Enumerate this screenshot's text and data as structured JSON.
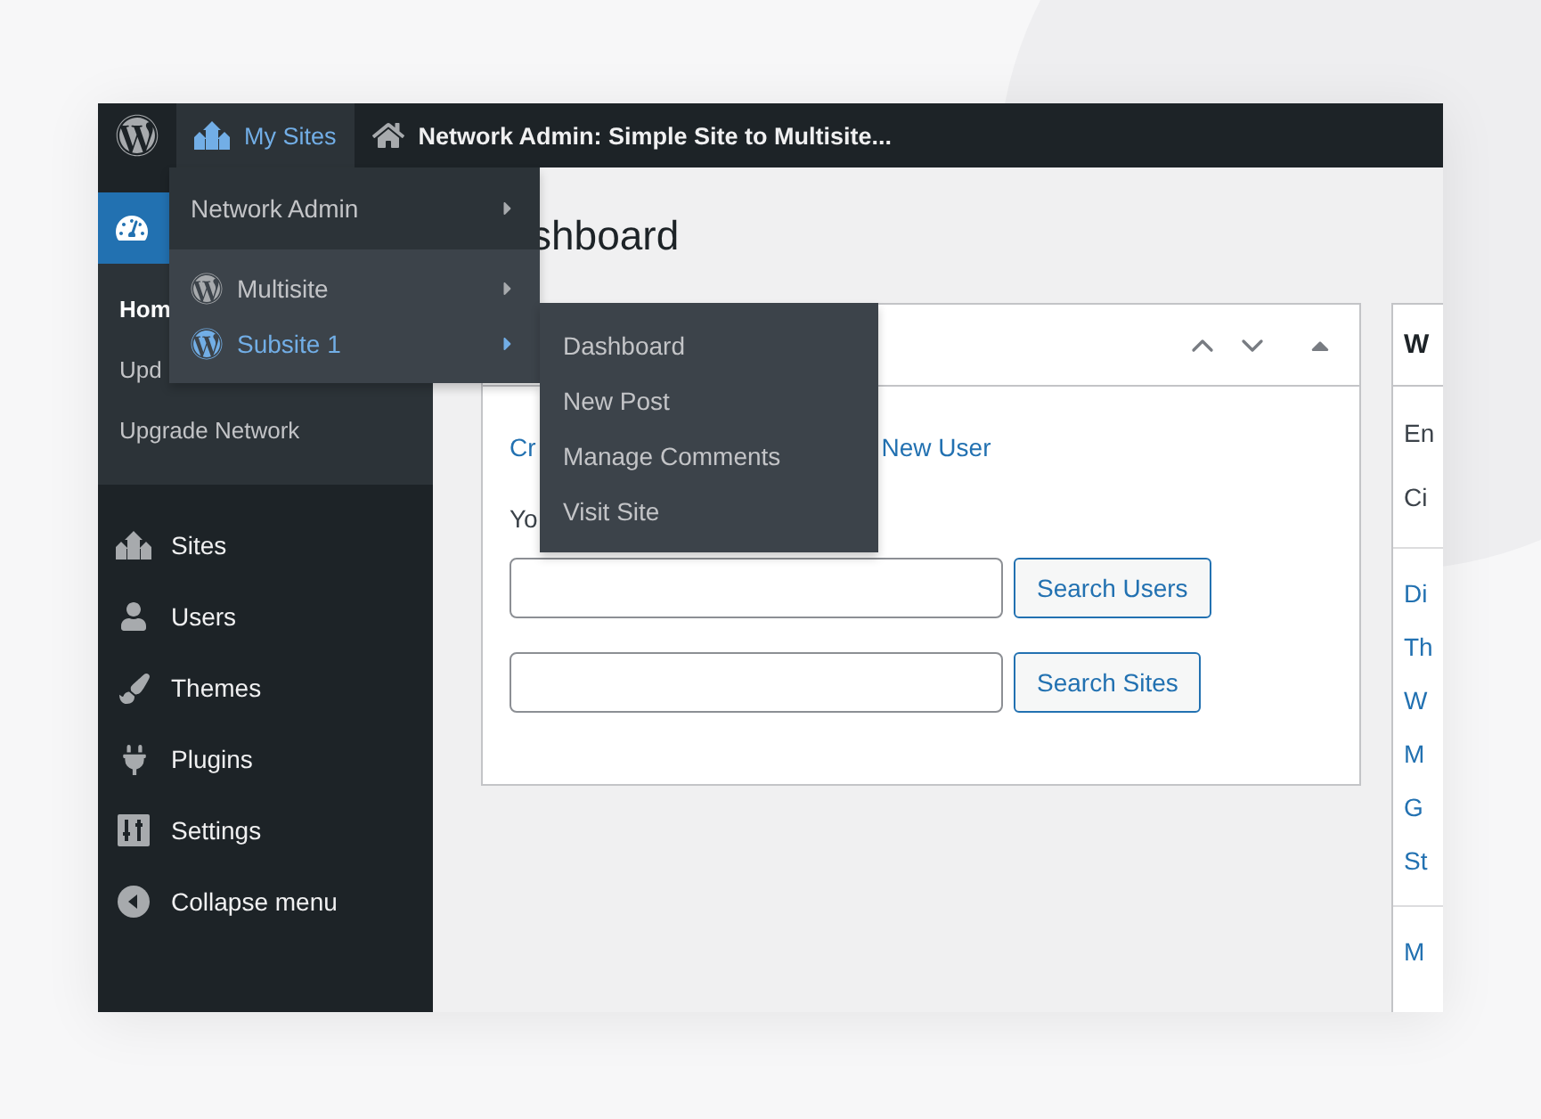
{
  "admin_bar": {
    "items": [
      {
        "kind": "logo"
      },
      {
        "kind": "sites",
        "label": "My Sites",
        "hovered": true
      },
      {
        "kind": "home",
        "label": "Network Admin: Simple Site to Multisite...",
        "hovered": false
      }
    ]
  },
  "sidebar": {
    "items": [
      {
        "current": true,
        "children": [
          {
            "label": "Hom",
            "current": true
          },
          {
            "label": "Upd",
            "current": false
          },
          {
            "label": "Upgrade Network",
            "current": false
          }
        ]
      },
      {
        "label": "Sites",
        "current": false
      },
      {
        "label": "Users",
        "current": false
      },
      {
        "label": "Themes",
        "current": false
      },
      {
        "label": "Plugins",
        "current": false
      },
      {
        "label": "Settings",
        "current": false
      },
      {
        "label": "Collapse menu",
        "current": false
      }
    ]
  },
  "my_sites_menu": {
    "groups": [
      {
        "items": [
          {
            "label": "Network Admin",
            "logo": false,
            "hovered": false
          }
        ]
      },
      {
        "items": [
          {
            "label": "Multisite",
            "logo": true,
            "hovered": false
          },
          {
            "label": "Subsite 1",
            "logo": true,
            "hovered": true
          }
        ]
      }
    ]
  },
  "submenu": {
    "items": [
      "Dashboard",
      "New Post",
      "Manage Comments",
      "Visit Site"
    ]
  },
  "main": {
    "heading": "shboard",
    "widget": {
      "links": [
        "Cr",
        "New User"
      ],
      "text": "Yo",
      "searches": [
        {
          "button": "Search Users"
        },
        {
          "button": "Search Sites"
        }
      ]
    },
    "side_panel": {
      "title": "W",
      "lines": [
        {
          "kind": "text",
          "text": "En"
        },
        {
          "kind": "text",
          "text": "Ci"
        },
        {
          "kind": "divider"
        },
        {
          "kind": "link",
          "text": "Di"
        },
        {
          "kind": "link",
          "text": "Th"
        },
        {
          "kind": "link",
          "text": "W"
        },
        {
          "kind": "link",
          "text": "M"
        },
        {
          "kind": "link",
          "text": "G"
        },
        {
          "kind": "link",
          "text": "St"
        },
        {
          "kind": "divider"
        },
        {
          "kind": "link",
          "text": "M"
        }
      ]
    }
  }
}
